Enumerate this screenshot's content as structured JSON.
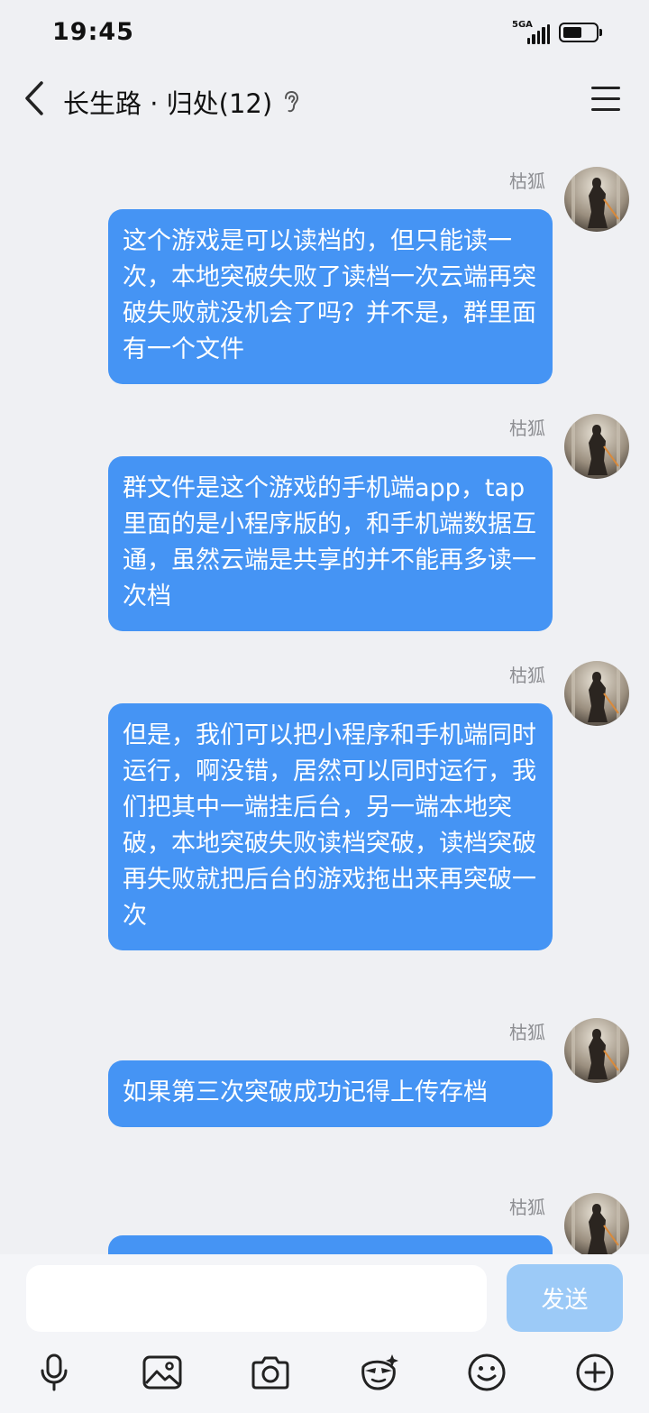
{
  "status_bar": {
    "time": "19:45",
    "network": "5GA",
    "battery_level": 0.6
  },
  "header": {
    "back_icon": "chevron-left-icon",
    "title": "长生路 · 归处(12)",
    "ear_icon": "ear-icon",
    "menu_icon": "menu-icon"
  },
  "messages": [
    {
      "sender": "枯狐",
      "text": "这个游戏是可以读档的，但只能读一次，本地突破失败了读档一次云端再突破失败就没机会了吗？并不是，群里面有一个文件"
    },
    {
      "sender": "枯狐",
      "text": "群文件是这个游戏的手机端app，tap里面的是小程序版的，和手机端数据互通，虽然云端是共享的并不能再多读一次档"
    },
    {
      "sender": "枯狐",
      "text": "但是，我们可以把小程序和手机端同时运行，啊没错，居然可以同时运行，我们把其中一端挂后台，另一端本地突破，本地突破失败读档突破，读档突破再失败就把后台的游戏拖出来再突破一次"
    },
    {
      "sender": "枯狐",
      "text": "如果第三次突破成功记得上传存档"
    },
    {
      "sender": "枯狐",
      "text": ""
    }
  ],
  "input": {
    "value": "",
    "placeholder": "",
    "send_label": "发送"
  },
  "toolbar": {
    "icons": [
      "microphone-icon",
      "image-icon",
      "camera-icon",
      "sticker-icon",
      "emoji-icon",
      "plus-icon"
    ]
  },
  "colors": {
    "bubble": "#4594f4",
    "send_button": "#9ccaf7",
    "background": "#eff0f3"
  }
}
